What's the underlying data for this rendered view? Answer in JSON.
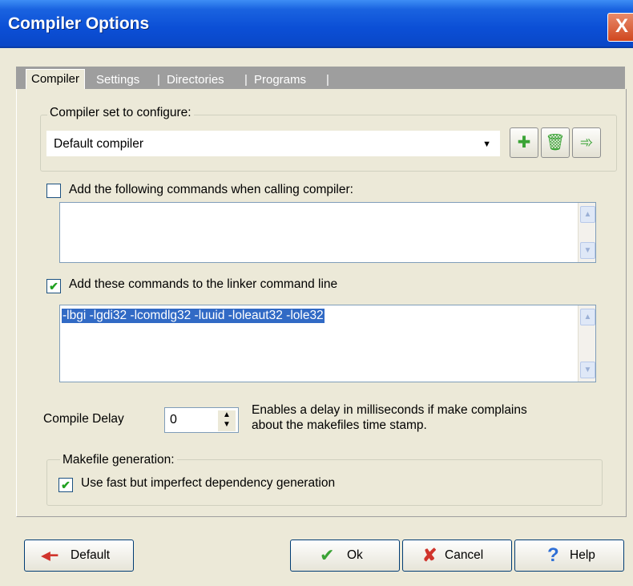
{
  "window": {
    "title": "Compiler Options",
    "close_label": "X"
  },
  "tabs": [
    "Compiler",
    "Settings",
    "Directories",
    "Programs"
  ],
  "tab_separator": "|",
  "compiler_set": {
    "group_label": "Compiler set to configure:",
    "selected": "Default compiler"
  },
  "compiler_commands": {
    "label": "Add the following commands when calling compiler:",
    "checked": false,
    "value": ""
  },
  "linker_commands": {
    "label": "Add these commands to the linker command line",
    "checked": true,
    "value": "-lbgi -lgdi32 -lcomdlg32  -luuid -loleaut32 -lole32"
  },
  "compile_delay": {
    "label": "Compile Delay",
    "value": "0",
    "help_line1": "Enables a delay in milliseconds if make complains",
    "help_line2": "about the makefiles time stamp."
  },
  "makefile": {
    "group_label": "Makefile generation:",
    "fast_dep_label": "Use fast but imperfect dependency generation",
    "fast_dep_checked": true
  },
  "buttons": {
    "default_label": "Default",
    "ok_label": "Ok",
    "cancel_label": "Cancel",
    "help_label": "Help"
  }
}
